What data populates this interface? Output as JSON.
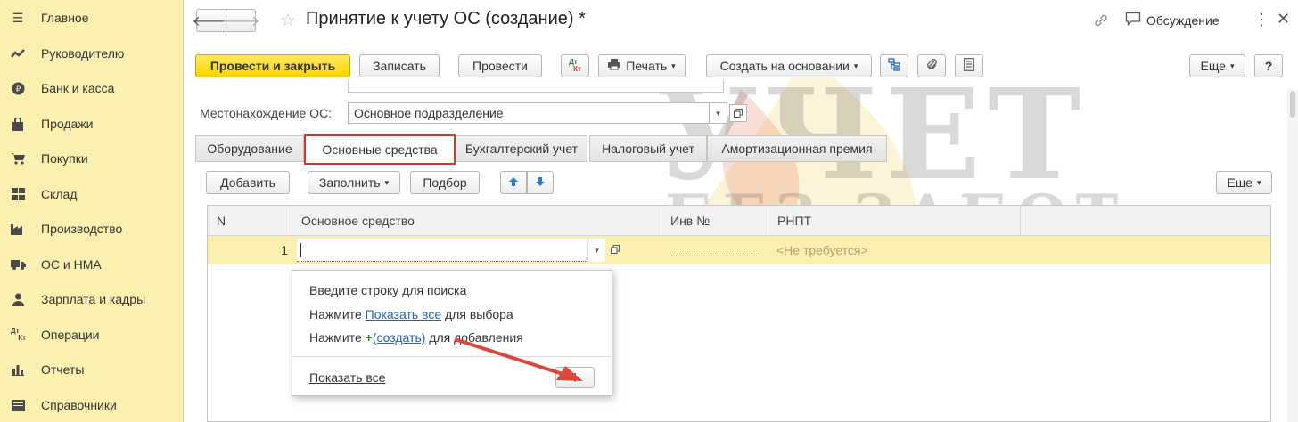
{
  "sidebar": {
    "items": [
      {
        "label": "Главное",
        "icon": "menu-icon"
      },
      {
        "label": "Руководителю",
        "icon": "trend-icon"
      },
      {
        "label": "Банк и касса",
        "icon": "coin-icon"
      },
      {
        "label": "Продажи",
        "icon": "bag-icon"
      },
      {
        "label": "Покупки",
        "icon": "cart-icon"
      },
      {
        "label": "Склад",
        "icon": "warehouse-icon"
      },
      {
        "label": "Производство",
        "icon": "factory-icon"
      },
      {
        "label": "ОС и НМА",
        "icon": "truck-icon"
      },
      {
        "label": "Зарплата и кадры",
        "icon": "person-icon"
      },
      {
        "label": "Операции",
        "icon": "dt-kt-icon"
      },
      {
        "label": "Отчеты",
        "icon": "bar-chart-icon"
      },
      {
        "label": "Справочники",
        "icon": "book-icon"
      }
    ]
  },
  "header": {
    "title": "Принятие к учету ОС (создание) *",
    "discussion": "Обсуждение"
  },
  "toolbar": {
    "post_close": "Провести и закрыть",
    "save": "Записать",
    "post": "Провести",
    "dtkt": "Дт Кт",
    "print": "Печать",
    "create_based": "Создать на основании",
    "more": "Еще",
    "help": "?"
  },
  "form": {
    "location_label": "Местонахождение ОС:",
    "location_value": "Основное подразделение"
  },
  "tabs": [
    "Оборудование",
    "Основные средства",
    "Бухгалтерский учет",
    "Налоговый учет",
    "Амортизационная премия"
  ],
  "table_toolbar": {
    "add": "Добавить",
    "fill": "Заполнить",
    "select": "Подбор",
    "more": "Еще"
  },
  "table": {
    "columns": [
      "N",
      "Основное средство",
      "Инв №",
      "РНПТ"
    ],
    "rows": [
      {
        "n": "1",
        "asset": "",
        "inv": "",
        "rnpt": "<Не требуется>"
      }
    ]
  },
  "popup": {
    "line1": "Введите строку для поиска",
    "line2_prefix": "Нажмите ",
    "line2_link": "Показать все",
    "line2_suffix": " для выбора",
    "line3_prefix": "Нажмите ",
    "line3_plus": "+",
    "line3_link": "(создать)",
    "line3_suffix": " для добавления",
    "show_all": "Показать все",
    "add_button": "+"
  },
  "watermark": {
    "line1": "УЧЕТ",
    "line2": "БЕЗ ЗАБОТ"
  },
  "colors": {
    "sidebar_bg": "#fbf0b0",
    "primary_button": "#f8d500",
    "active_tab_border": "#d03b2b",
    "link": "#2864b4",
    "arrow": "#d9473a"
  }
}
